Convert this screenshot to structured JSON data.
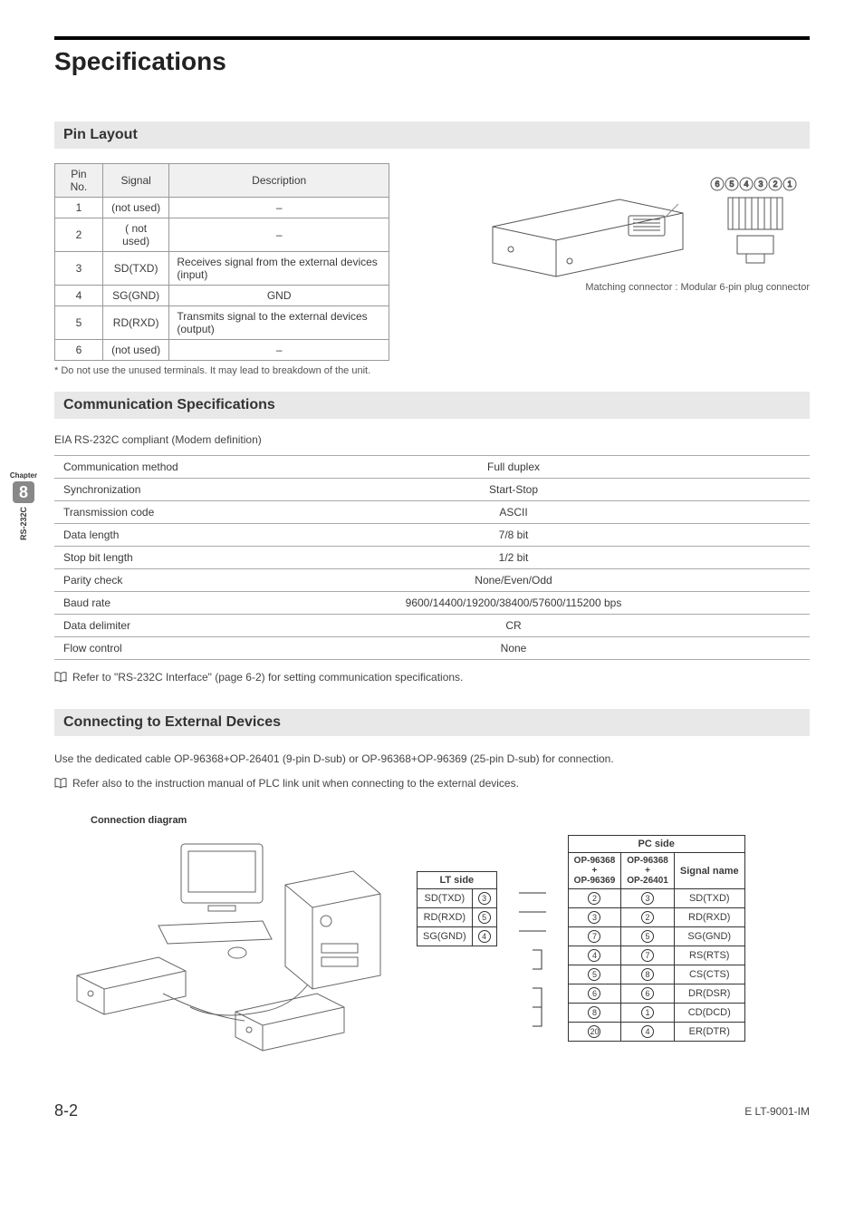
{
  "title": "Specifications",
  "sections": {
    "pin_layout": "Pin Layout",
    "comm_spec": "Communication Specifications",
    "connecting": "Connecting to External Devices"
  },
  "pin_table": {
    "headers": [
      "Pin No.",
      "Signal",
      "Description"
    ],
    "rows": [
      {
        "pin": "1",
        "signal": "(not used)",
        "desc": "–"
      },
      {
        "pin": "2",
        "signal": "( not used)",
        "desc": "–"
      },
      {
        "pin": "3",
        "signal": "SD(TXD)",
        "desc": "Receives signal from the external devices (input)"
      },
      {
        "pin": "4",
        "signal": "SG(GND)",
        "desc": "GND"
      },
      {
        "pin": "5",
        "signal": "RD(RXD)",
        "desc": "Transmits signal to the external devices (output)"
      },
      {
        "pin": "6",
        "signal": "(not used)",
        "desc": "–"
      }
    ],
    "footnote": "* Do not use the unused terminals. It may lead to breakdown of the unit."
  },
  "connector_note": "Matching connector : Modular 6-pin plug connector",
  "compliance": "EIA RS-232C compliant (Modem definition)",
  "comm_table": [
    {
      "k": "Communication method",
      "v": "Full duplex"
    },
    {
      "k": "Synchronization",
      "v": "Start-Stop"
    },
    {
      "k": "Transmission code",
      "v": "ASCII"
    },
    {
      "k": "Data length",
      "v": "7/8 bit"
    },
    {
      "k": "Stop bit length",
      "v": "1/2 bit"
    },
    {
      "k": "Parity check",
      "v": "None/Even/Odd"
    },
    {
      "k": "Baud rate",
      "v": "9600/14400/19200/38400/57600/115200 bps"
    },
    {
      "k": "Data delimiter",
      "v": "CR"
    },
    {
      "k": "Flow control",
      "v": "None"
    }
  ],
  "ref1": "Refer to \"RS-232C Interface\" (page 6-2) for setting communication specifications.",
  "connecting_body1": "Use the dedicated cable OP-96368+OP-26401 (9-pin D-sub) or OP-96368+OP-96369 (25-pin D-sub) for connection.",
  "connecting_body2": "Refer also to the instruction manual of PLC link unit when connecting to the external devices.",
  "conn_diag_label": "Connection diagram",
  "lt_side": {
    "header": "LT side",
    "rows": [
      {
        "sig": "SD(TXD)",
        "pin": "3"
      },
      {
        "sig": "RD(RXD)",
        "pin": "5"
      },
      {
        "sig": "SG(GND)",
        "pin": "4"
      }
    ]
  },
  "pc_side": {
    "header": "PC side",
    "col1_top": "OP-96368",
    "col1_bot": "OP-96369",
    "col2_top": "OP-96368",
    "col2_bot": "OP-26401",
    "col3": "Signal name",
    "plus": "+",
    "rows": [
      {
        "a": "2",
        "b": "3",
        "sig": "SD(TXD)"
      },
      {
        "a": "3",
        "b": "2",
        "sig": "RD(RXD)"
      },
      {
        "a": "7",
        "b": "5",
        "sig": "SG(GND)"
      },
      {
        "a": "4",
        "b": "7",
        "sig": "RS(RTS)"
      },
      {
        "a": "5",
        "b": "8",
        "sig": "CS(CTS)"
      },
      {
        "a": "6",
        "b": "6",
        "sig": "DR(DSR)"
      },
      {
        "a": "8",
        "b": "1",
        "sig": "CD(DCD)"
      },
      {
        "a": "20",
        "b": "4",
        "sig": "ER(DTR)"
      }
    ]
  },
  "chapter_tab": {
    "label": "Chapter",
    "num": "8",
    "side": "RS-232C"
  },
  "footer": {
    "page": "8-2",
    "doc": "E LT-9001-IM"
  }
}
